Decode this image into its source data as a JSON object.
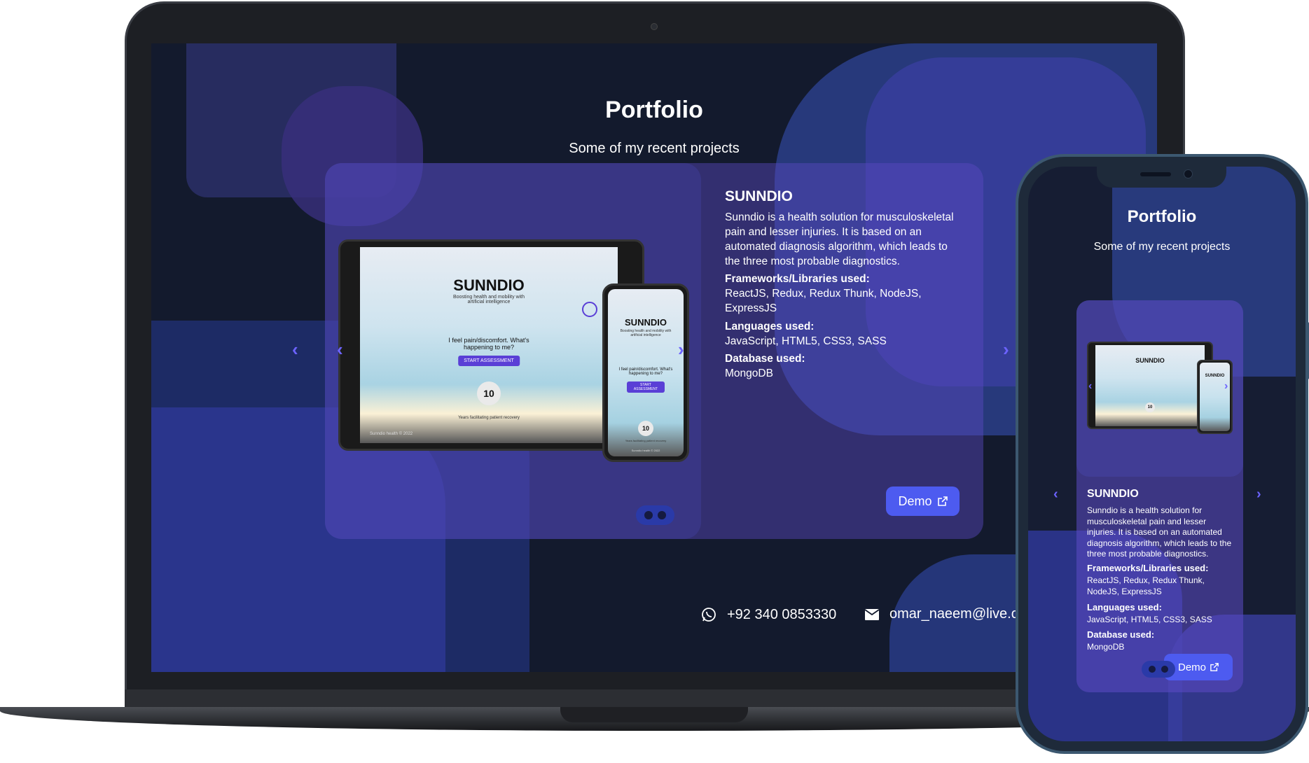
{
  "portfolio": {
    "title": "Portfolio",
    "subtitle": "Some of my recent projects"
  },
  "project": {
    "name": "SUNNDIO",
    "description": "Sunndio is a health solution for musculoskeletal pain and lesser injuries. It is based on an automated diagnosis algorithm, which leads to the three most probable diagnostics.",
    "frameworks_label": "Frameworks/Libraries used:",
    "frameworks": "ReactJS, Redux, Redux Thunk, NodeJS, ExpressJS",
    "languages_label": "Languages used:",
    "languages": "JavaScript, HTML5, CSS3, SASS",
    "database_label": "Database used:",
    "database": "MongoDB",
    "demo_label": "Demo"
  },
  "mockup": {
    "brand": "SUNNDIO",
    "tagline": "Boosting health and mobility with artificial intelligence",
    "question": "I feel pain/discomfort. What's happening to me?",
    "cta": "START ASSESSMENT",
    "years": "10",
    "years_caption": "Years facilitating patient recovery",
    "footer": "Sunndio health © 2022"
  },
  "contact": {
    "phone": "+92 340 0853330",
    "email": "omar_naeem@live.c"
  },
  "icons": {
    "prev": "chevron-left-icon",
    "next": "chevron-right-icon",
    "external": "external-link-icon",
    "whatsapp": "whatsapp-icon",
    "mail": "mail-icon"
  },
  "colors": {
    "accent": "#4d5bf0",
    "chevron": "#6c63ff",
    "card": "#5c4ac4",
    "background": "#131a2d"
  }
}
